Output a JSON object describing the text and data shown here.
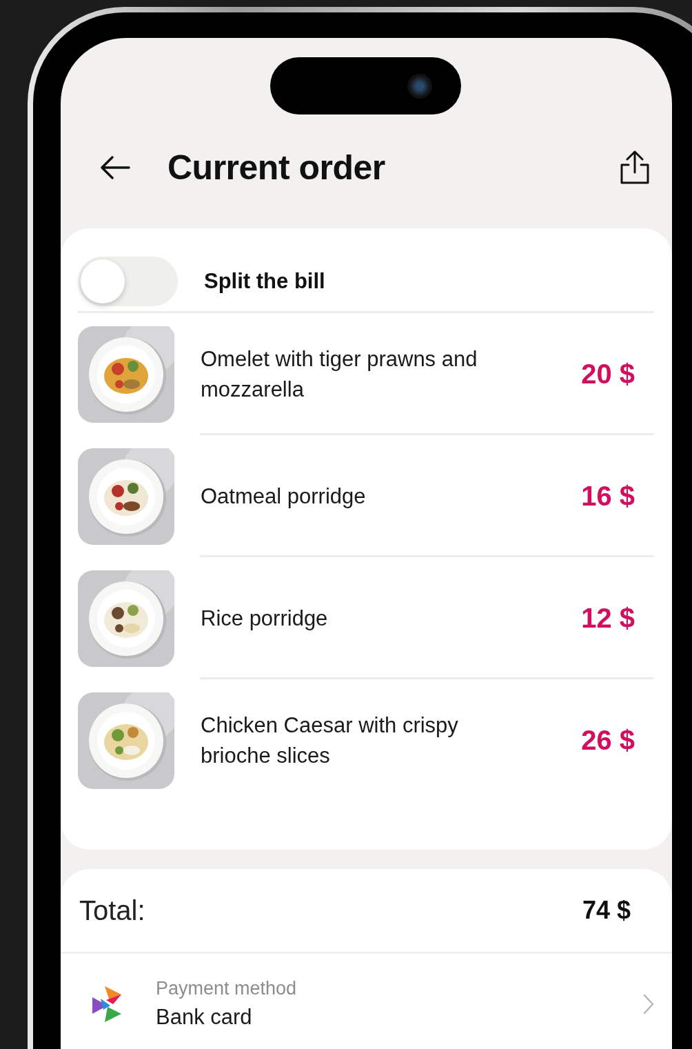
{
  "header": {
    "title": "Current order"
  },
  "split_bill": {
    "label": "Split the bill",
    "on": false
  },
  "items": [
    {
      "name": "Omelet with tiger prawns and mozzarella",
      "price": "20 $"
    },
    {
      "name": "Oatmeal porridge",
      "price": "16 $"
    },
    {
      "name": "Rice porridge",
      "price": "12 $"
    },
    {
      "name": "Chicken Caesar with crispy brioche slices",
      "price": "26 $"
    }
  ],
  "total": {
    "label": "Total:",
    "amount": "74 $"
  },
  "payment": {
    "label": "Payment method",
    "value": "Bank card"
  }
}
